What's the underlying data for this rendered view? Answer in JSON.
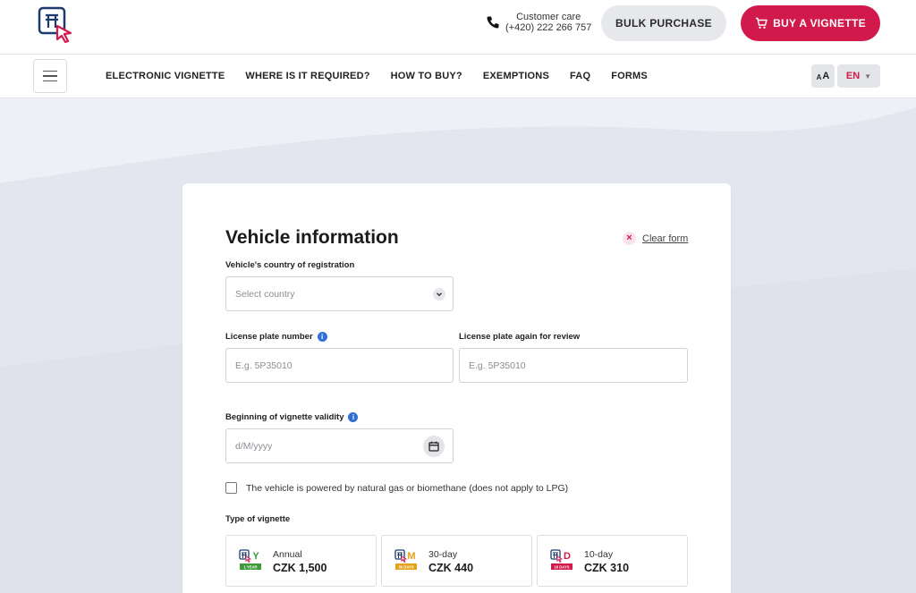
{
  "header": {
    "customer_care_label": "Customer care",
    "customer_care_phone": "(+420) 222 266 757",
    "bulk_purchase_label": "BULK PURCHASE",
    "buy_vignette_label": "BUY A VIGNETTE",
    "brand_color": "#d2194b"
  },
  "nav": {
    "items": [
      {
        "label": "ELECTRONIC VIGNETTE"
      },
      {
        "label": "WHERE IS IT REQUIRED?"
      },
      {
        "label": "HOW TO BUY?"
      },
      {
        "label": "EXEMPTIONS"
      },
      {
        "label": "FAQ"
      },
      {
        "label": "FORMS"
      }
    ],
    "font_size_big": "A",
    "font_size_small": "A",
    "language": "EN"
  },
  "form": {
    "title": "Vehicle information",
    "clear_label": "Clear form",
    "country_label": "Vehicle's country of registration",
    "country_placeholder": "Select country",
    "plate_label": "License plate number",
    "plate_placeholder": "E.g. 5P35010",
    "plate_again_label": "License plate again for review",
    "plate_again_placeholder": "E.g. 5P35010",
    "validity_label": "Beginning of vignette validity",
    "validity_placeholder": "d/M/yyyy",
    "gas_checkbox_label": "The vehicle is powered by natural gas or biomethane (does not apply to LPG)",
    "gas_checkbox_checked": false,
    "vignette_type_label": "Type of vignette",
    "vignette_types": [
      {
        "name": "Annual",
        "price": "CZK 1,500",
        "letter": "Y",
        "badge": "1 YEAR",
        "color": "#3d9a3d"
      },
      {
        "name": "30-day",
        "price": "CZK 440",
        "letter": "M",
        "badge": "30 DAYS",
        "color": "#e3a21a"
      },
      {
        "name": "10-day",
        "price": "CZK 310",
        "letter": "D",
        "badge": "10 DAYS",
        "color": "#d2194b"
      }
    ]
  }
}
